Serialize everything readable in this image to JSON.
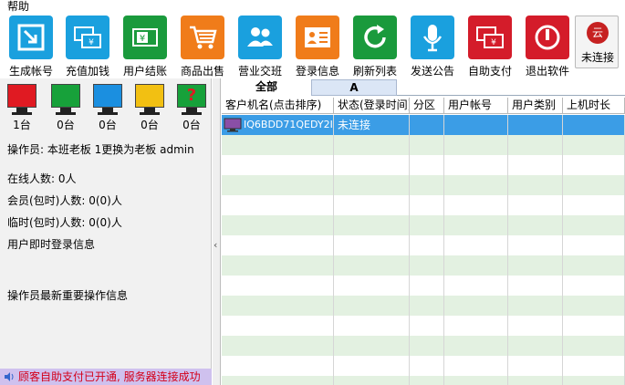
{
  "menu": {
    "help": "帮助"
  },
  "toolbar": {
    "items": [
      {
        "label": "生成帐号",
        "icon": "generate-account-icon",
        "color": "#1aa0de"
      },
      {
        "label": "充值加钱",
        "icon": "recharge-icon",
        "color": "#1aa0de"
      },
      {
        "label": "用户结账",
        "icon": "checkout-icon",
        "color": "#1a9a3c"
      },
      {
        "label": "商品出售",
        "icon": "shopping-cart-icon",
        "color": "#f07c1a"
      },
      {
        "label": "营业交班",
        "icon": "shift-handover-icon",
        "color": "#1aa0de"
      },
      {
        "label": "登录信息",
        "icon": "login-info-icon",
        "color": "#f07c1a"
      },
      {
        "label": "刷新列表",
        "icon": "refresh-icon",
        "color": "#1a9a3c"
      },
      {
        "label": "发送公告",
        "icon": "microphone-icon",
        "color": "#1aa0de"
      },
      {
        "label": "自助支付",
        "icon": "self-pay-icon",
        "color": "#d41c2a"
      },
      {
        "label": "退出软件",
        "icon": "power-icon",
        "color": "#d41c2a"
      }
    ],
    "cloud": {
      "glyph": "云",
      "label": "未连接"
    }
  },
  "monitors": [
    {
      "count": "1台",
      "color": "#e01a22"
    },
    {
      "count": "0台",
      "color": "#17a13a"
    },
    {
      "count": "0台",
      "color": "#1b8fe0"
    },
    {
      "count": "0台",
      "color": "#f2c012"
    },
    {
      "count": "0台",
      "color": "#17a13a",
      "mark": "?"
    }
  ],
  "info": {
    "operator": "操作员: 本班老板 1更换为老板 admin",
    "online": "在线人数: 0人",
    "member": "会员(包时)人数: 0(0)人",
    "temp": "临时(包时)人数: 0(0)人",
    "login_info": "用户即时登录信息",
    "op_info": "操作员最新重要操作信息"
  },
  "status": "顾客自助支付已开通, 服务器连接成功",
  "tabs": [
    "全部",
    "A"
  ],
  "columns": [
    "客户机名(点击排序)",
    "状态(登录时间)",
    "分区",
    "用户帐号",
    "用户类别",
    "上机时长"
  ],
  "rows": [
    {
      "name": "IQ6BDD71QEDY2I1",
      "status": "未连接"
    }
  ]
}
